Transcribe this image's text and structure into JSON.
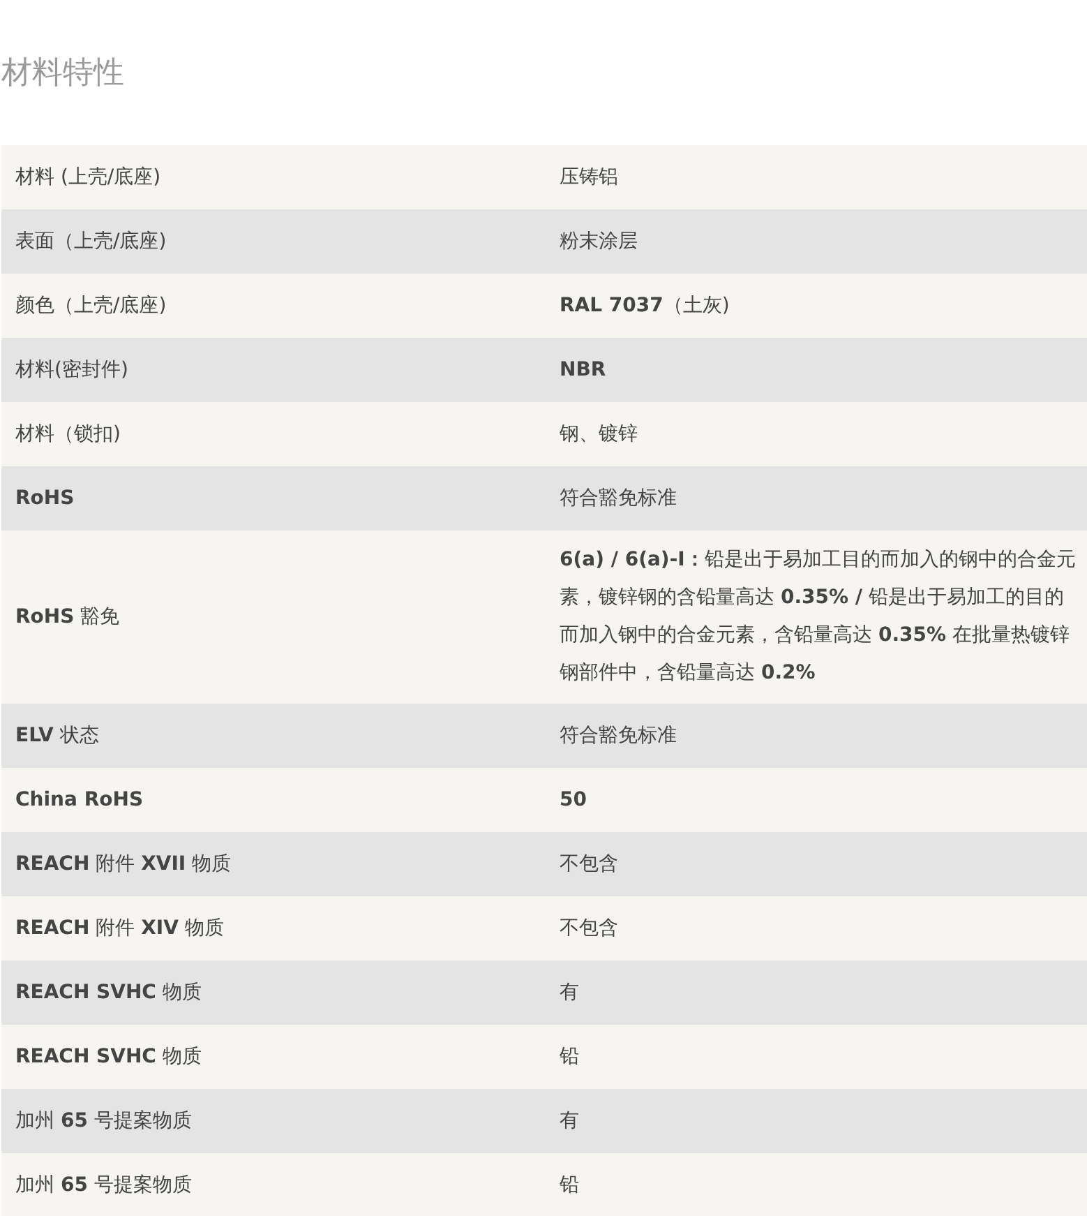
{
  "title": "材料特性",
  "rows": [
    {
      "label": "材料 (上壳/底座)",
      "value": "压铸铝"
    },
    {
      "label": "表面（上壳/底座)",
      "value": "粉末涂层"
    },
    {
      "label": "颜色（上壳/底座)",
      "value": "**RAL 7037**（土灰)"
    },
    {
      "label": "材料(密封件)",
      "value": "**NBR**"
    },
    {
      "label": "材料（锁扣)",
      "value": "钢、镀锌"
    },
    {
      "label": "**RoHS**",
      "value": "符合豁免标准"
    },
    {
      "label": "**RoHS** 豁免",
      "value": "**6(a) / 6(a)-I：**铅是出于易加工目的而加入的钢中的合金元素，镀锌钢的含铅量高达 **0.35% /** 铅是出于易加工的目的而加入钢中的合金元素，含铅量高达 **0.35%** 在批量热镀锌钢部件中，含铅量高达 **0.2%**"
    },
    {
      "label": "**ELV** 状态",
      "value": "符合豁免标准"
    },
    {
      "label": "**China RoHS**",
      "value": "**50**"
    },
    {
      "label": "**REACH** 附件 **XVII** 物质",
      "value": "不包含"
    },
    {
      "label": "**REACH** 附件 **XIV** 物质",
      "value": "不包含"
    },
    {
      "label": "**REACH SVHC** 物质",
      "value": "有"
    },
    {
      "label": "**REACH SVHC** 物质",
      "value": "铅"
    },
    {
      "label": "加州 **65** 号提案物质",
      "value": "有"
    },
    {
      "label": "加州 **65** 号提案物质",
      "value": "铅"
    }
  ]
}
